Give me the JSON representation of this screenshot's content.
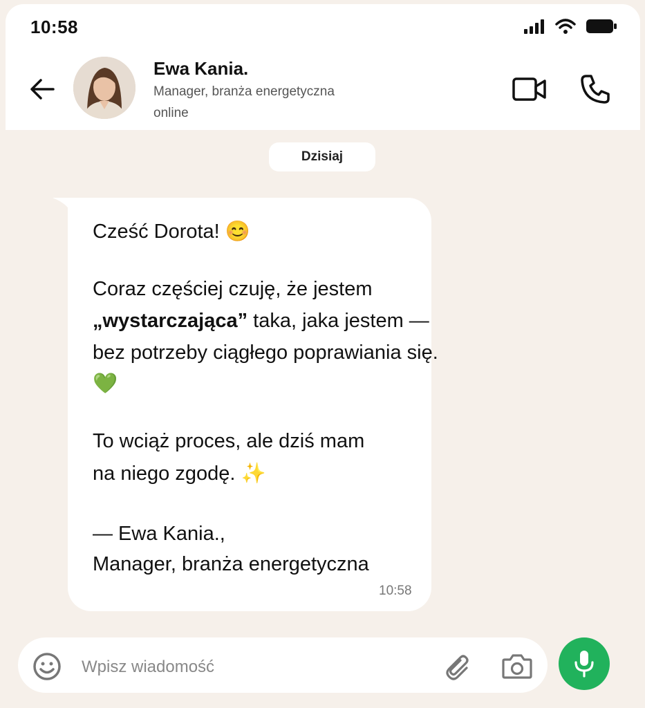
{
  "status_bar": {
    "time": "10:58"
  },
  "header": {
    "contact_name": "Ewa Kania.",
    "contact_role": "Manager, branża energetyczna",
    "contact_status": "online"
  },
  "date_separator": "Dzisiaj",
  "message": {
    "greeting": "Cześć Dorota! 😊",
    "line_1": "Coraz częściej czuję, że jestem",
    "line_2_bold": "„wystarczająca”",
    "line_2_rest": " taka, jaka jestem —",
    "line_3": "bez potrzeby ciągłego poprawiania się.",
    "line_4": "💚",
    "line_5": "To wciąż proces, ale dziś mam",
    "line_6": "na niego zgodę. ✨",
    "signature_1": "— Ewa Kania.,",
    "signature_2": "Manager, branża energetyczna",
    "time": "10:58"
  },
  "composer": {
    "placeholder": "Wpisz wiadomość"
  },
  "colors": {
    "accent_green": "#21b25c",
    "chat_background": "#f6f0ea",
    "bubble": "#ffffff"
  }
}
